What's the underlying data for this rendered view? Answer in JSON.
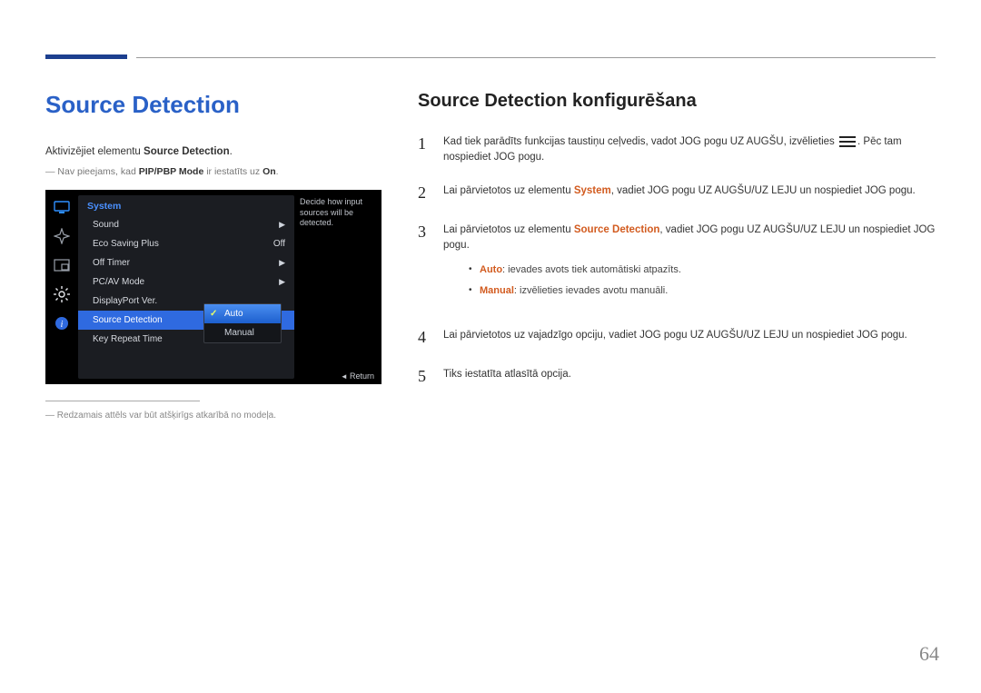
{
  "page_number": "64",
  "left": {
    "title": "Source Detection",
    "intro_prefix": "Aktivizējiet elementu ",
    "intro_bold": "Source Detection",
    "intro_suffix": ".",
    "note_prefix": "Nav pieejams, kad ",
    "note_bold": "PIP/PBP Mode",
    "note_mid": " ir iestatīts uz ",
    "note_on": "On",
    "note_end": ".",
    "footnote": "Redzamais attēls var būt atšķirīgs atkarībā no modeļa."
  },
  "osd": {
    "header": "System",
    "rows": [
      {
        "label": "Sound",
        "value": "",
        "caret": true
      },
      {
        "label": "Eco Saving Plus",
        "value": "Off",
        "caret": false
      },
      {
        "label": "Off Timer",
        "value": "",
        "caret": true
      },
      {
        "label": "PC/AV Mode",
        "value": "",
        "caret": true
      },
      {
        "label": "DisplayPort Ver.",
        "value": "",
        "caret": false
      },
      {
        "label": "Source Detection",
        "value": "",
        "caret": false,
        "selected": true
      },
      {
        "label": "Key Repeat Time",
        "value": "",
        "caret": false
      }
    ],
    "help": "Decide how input sources will be detected.",
    "popup": [
      "Auto",
      "Manual"
    ],
    "return": "Return"
  },
  "right": {
    "title": "Source Detection konfigurēšana",
    "steps": {
      "s1a": "Kad tiek parādīts funkcijas taustiņu ceļvedis, vadot JOG pogu UZ AUGŠU, izvēlieties ",
      "s1b": ". Pēc tam nospiediet JOG pogu.",
      "s2a": "Lai pārvietotos uz elementu ",
      "s2_bold": "System",
      "s2b": ", vadiet JOG pogu UZ AUGŠU/UZ LEJU un nospiediet JOG pogu.",
      "s3a": "Lai pārvietotos uz elementu ",
      "s3_bold": "Source Detection",
      "s3b": ", vadiet JOG pogu UZ AUGŠU/UZ LEJU un nospiediet JOG pogu.",
      "bullet_auto_label": "Auto",
      "bullet_auto_text": ": ievades avots tiek automātiski atpazīts.",
      "bullet_manual_label": "Manual",
      "bullet_manual_text": ": izvēlieties ievades avotu manuāli.",
      "s4": "Lai pārvietotos uz vajadzīgo opciju, vadiet JOG pogu UZ AUGŠU/UZ LEJU un nospiediet JOG pogu.",
      "s5": "Tiks iestatīta atlasītā opcija."
    }
  }
}
